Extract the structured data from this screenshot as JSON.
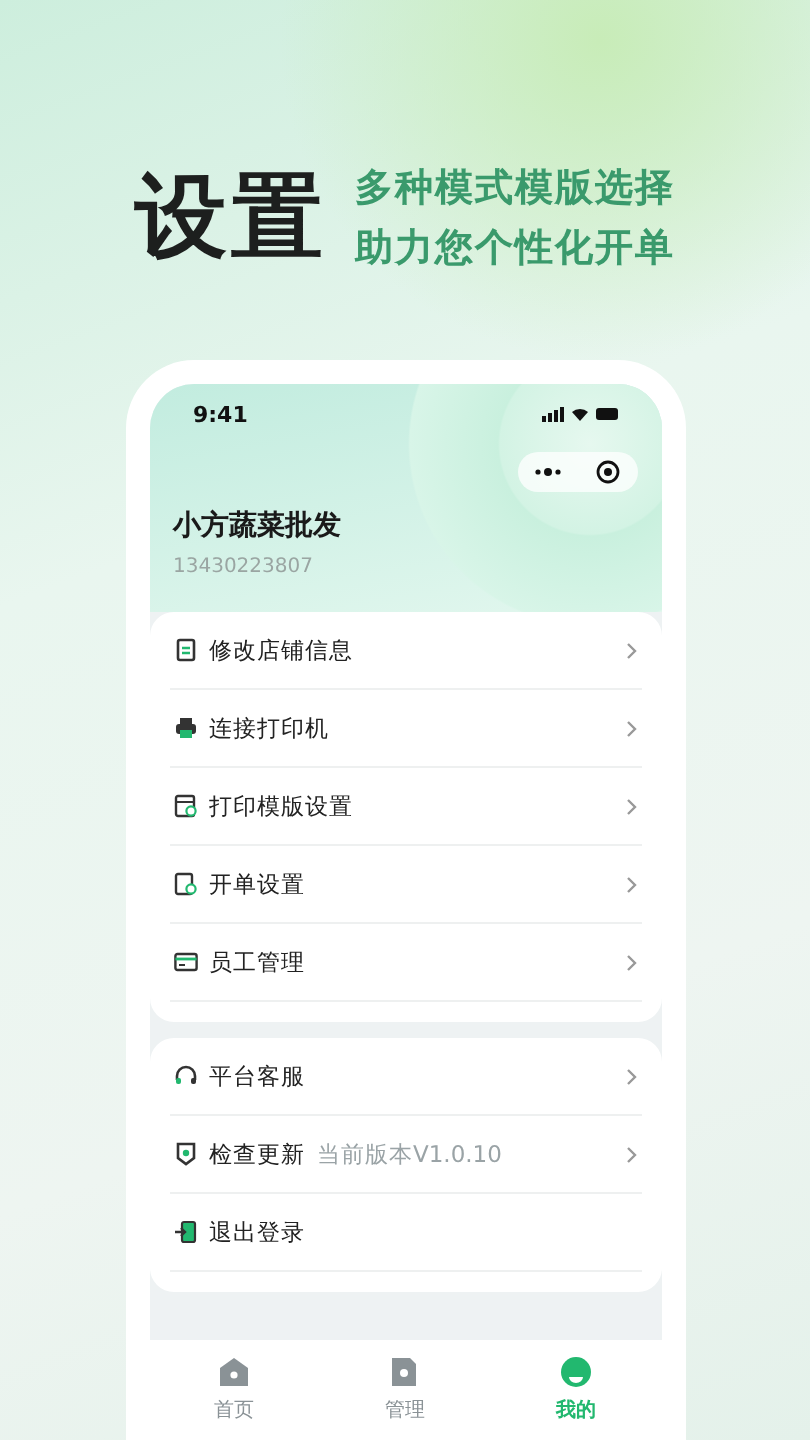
{
  "headline": {
    "title": "设置",
    "lines": [
      "多种模式模版选择",
      "助力您个性化开单"
    ]
  },
  "status_bar": {
    "time": "9:41"
  },
  "profile": {
    "name": "小方蔬菜批发",
    "phone": "13430223807"
  },
  "groups": [
    {
      "items": [
        {
          "label": "修改店铺信息",
          "chevron": true
        },
        {
          "label": "连接打印机",
          "chevron": true
        },
        {
          "label": "打印模版设置",
          "chevron": true
        },
        {
          "label": "开单设置",
          "chevron": true
        },
        {
          "label": "员工管理",
          "chevron": true
        }
      ]
    },
    {
      "items": [
        {
          "label": "平台客服",
          "chevron": true
        },
        {
          "label": "检查更新",
          "note": "当前版本V1.0.10",
          "chevron": true
        },
        {
          "label": "退出登录",
          "chevron": false
        }
      ]
    }
  ],
  "tabs": [
    {
      "label": "首页",
      "selected": false
    },
    {
      "label": "管理",
      "selected": false
    },
    {
      "label": "我的",
      "selected": true
    }
  ]
}
